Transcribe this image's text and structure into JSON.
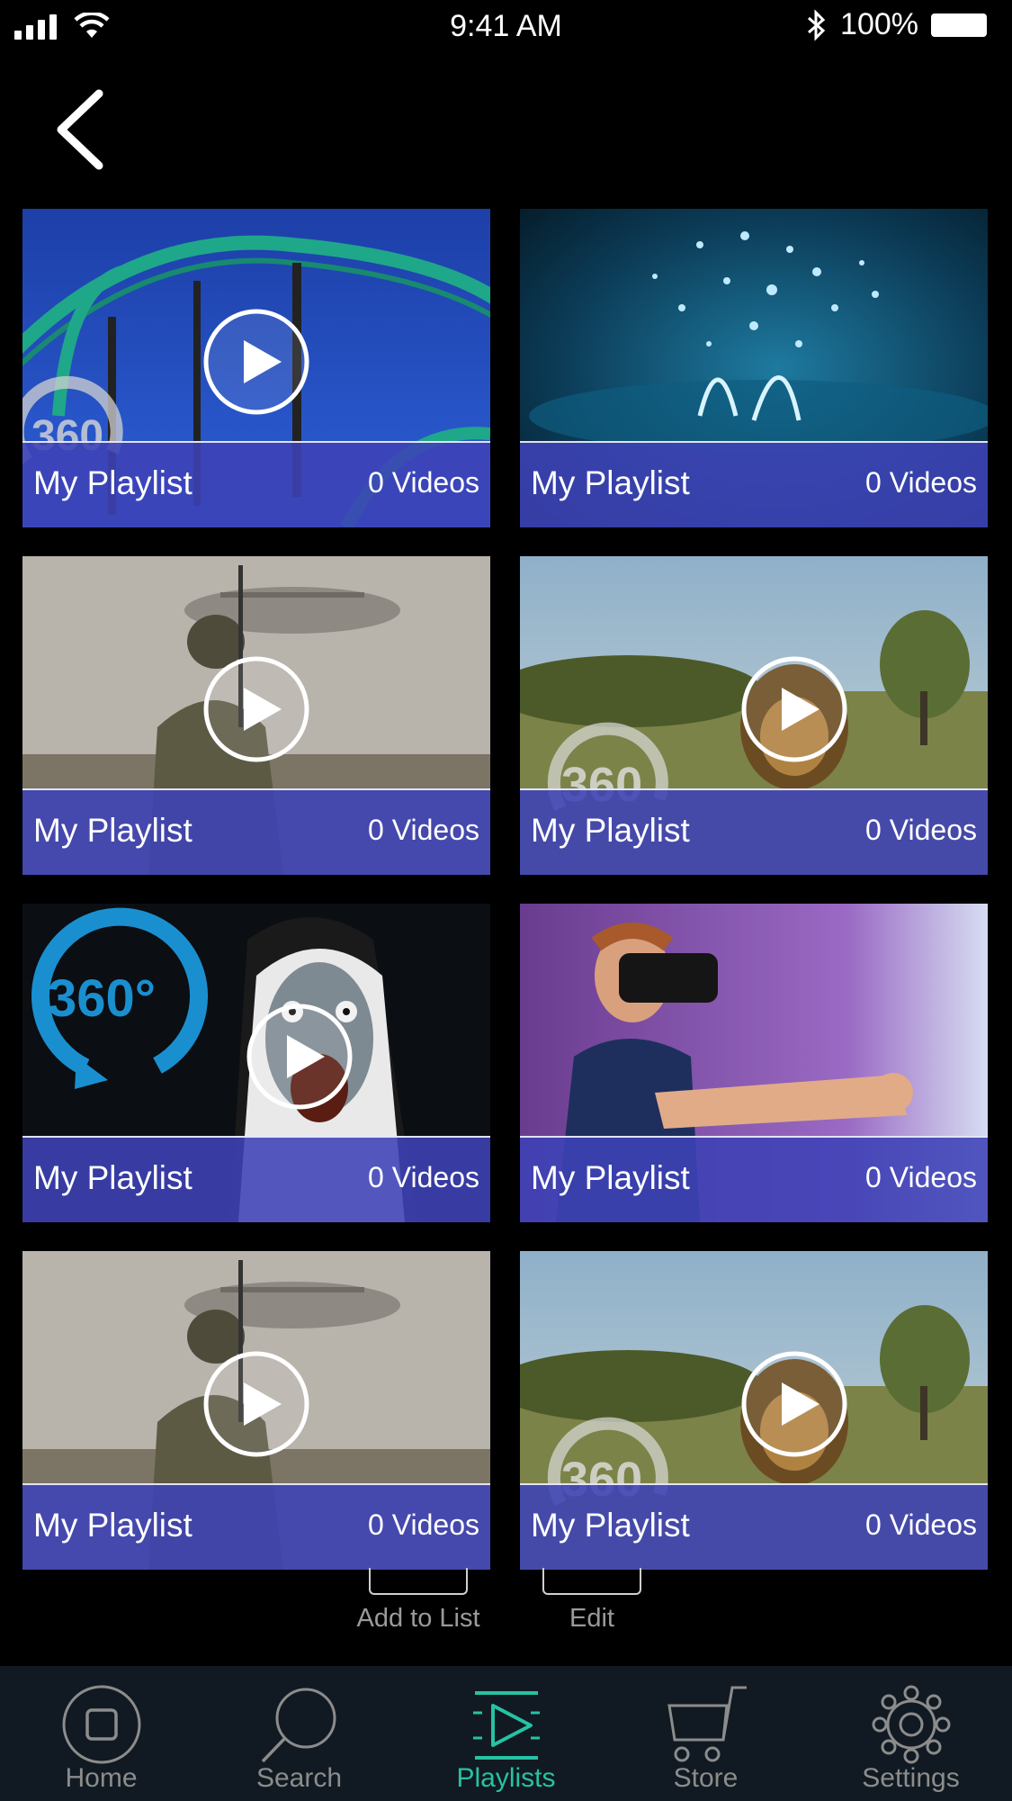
{
  "status_bar": {
    "time": "9:41 AM",
    "battery": "100%",
    "icons": [
      "signal-icon",
      "wifi-icon",
      "bluetooth-icon",
      "battery-icon"
    ]
  },
  "header": {
    "back_icon": "chevron-left-icon"
  },
  "playlists": [
    {
      "title": "My Playlist",
      "count": "0 Videos",
      "badge_360": "360",
      "has_play": true
    },
    {
      "title": "My Playlist",
      "count": "0 Videos",
      "badge_360": "",
      "has_play": false
    },
    {
      "title": "My Playlist",
      "count": "0 Videos",
      "badge_360": "",
      "has_play": true
    },
    {
      "title": "My Playlist",
      "count": "0 Videos",
      "badge_360": "360",
      "has_play": true
    },
    {
      "title": "My Playlist",
      "count": "0 Videos",
      "badge_360": "360°",
      "has_play": true
    },
    {
      "title": "My Playlist",
      "count": "0 Videos",
      "badge_360": "",
      "has_play": false
    },
    {
      "title": "My Playlist",
      "count": "0 Videos",
      "badge_360": "",
      "has_play": true
    },
    {
      "title": "My Playlist",
      "count": "0 Videos",
      "badge_360": "360",
      "has_play": true
    }
  ],
  "actions": {
    "add_to_list": "Add to List",
    "edit": "Edit"
  },
  "tab_bar": {
    "active": "Playlists",
    "tabs": [
      {
        "label": "Home",
        "icon": "home-icon"
      },
      {
        "label": "Search",
        "icon": "search-icon"
      },
      {
        "label": "Playlists",
        "icon": "playlists-icon"
      },
      {
        "label": "Store",
        "icon": "cart-icon"
      },
      {
        "label": "Settings",
        "icon": "gear-icon"
      }
    ]
  },
  "colors": {
    "background": "#000000",
    "caption": "#3e42b6",
    "accent": "#27c2a3",
    "tab_bar": "#111a22",
    "inactive": "#8c8c8c"
  }
}
